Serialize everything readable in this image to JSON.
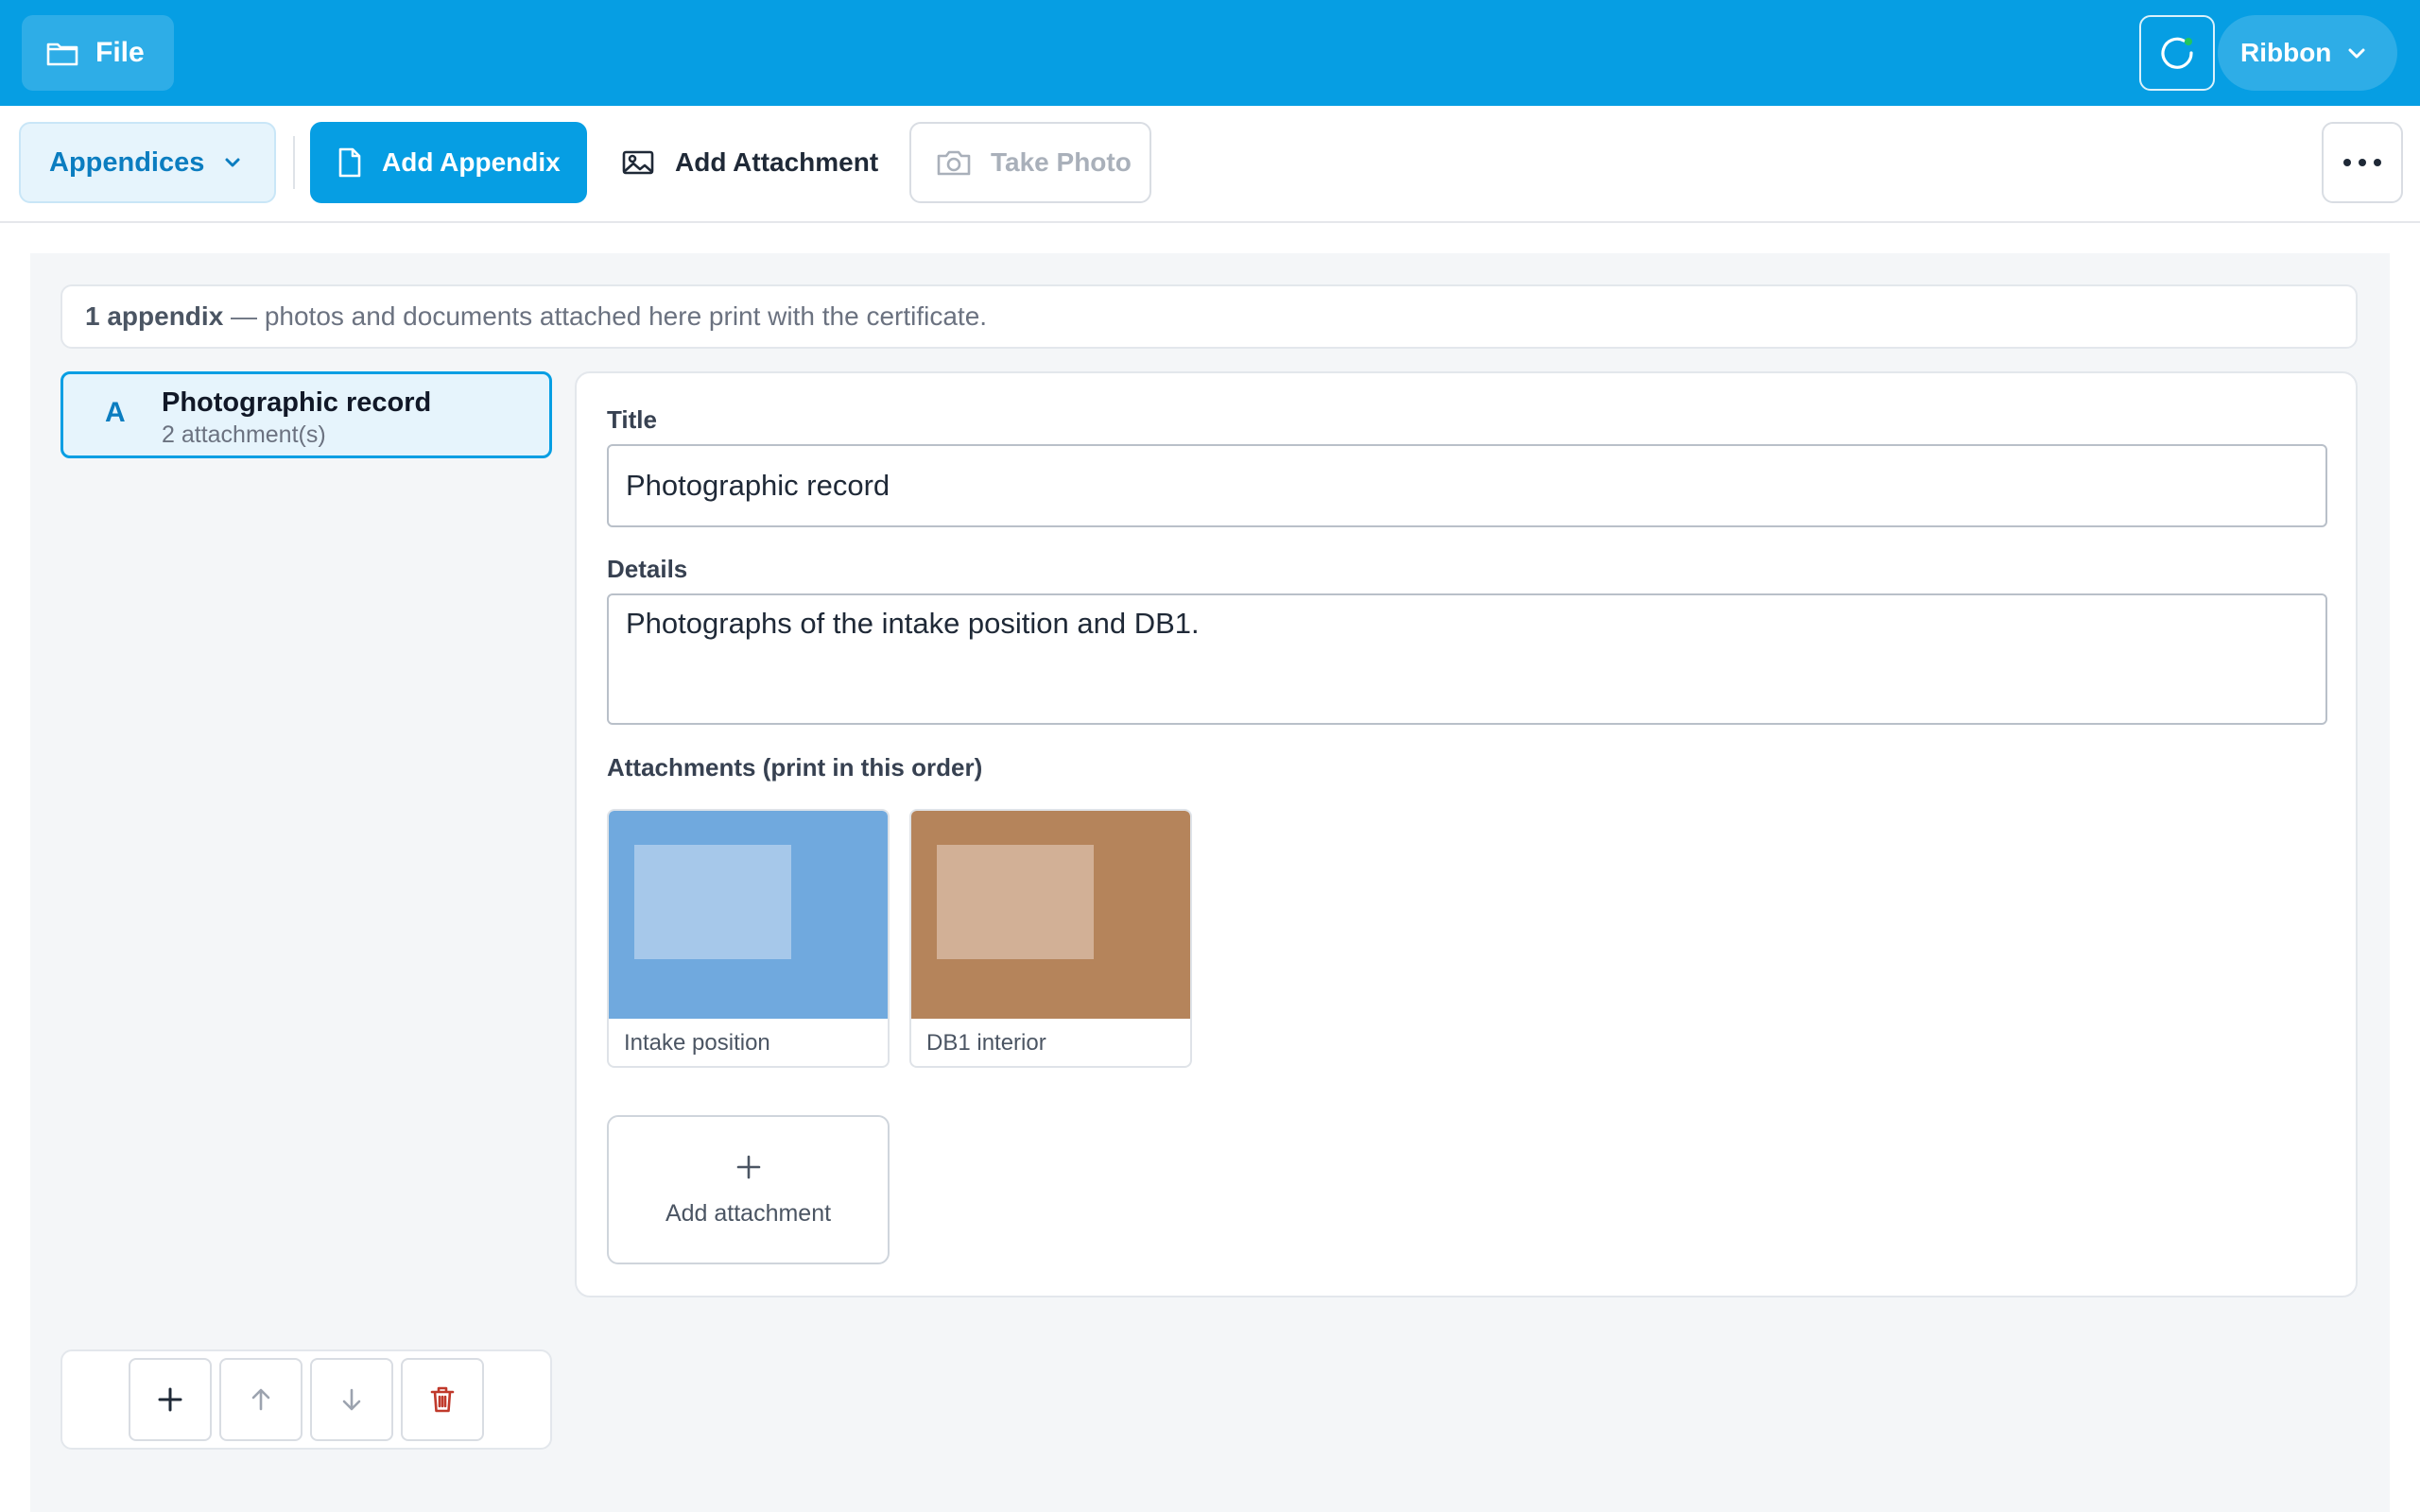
{
  "titlebar": {
    "file_label": "File",
    "ribbon_label": "Ribbon",
    "file_icon": "folder-icon",
    "sync_icon": "sync-icon",
    "ribbon_icon": "chevron-down-icon",
    "color": "#069ee3"
  },
  "toolbar": {
    "appendices_label": "Appendices",
    "add_appendix_label": "Add Appendix",
    "add_attachment_label": "Add Attachment",
    "take_photo_label": "Take Photo",
    "take_photo_disabled": true,
    "more_icon": "more-horizontal-icon"
  },
  "summary": {
    "count": "1 appendix",
    "text": " — photos and documents attached here print with the certificate."
  },
  "appendices": [
    {
      "letter": "A",
      "title": "Photographic record",
      "subtitle": "2 attachment(s)",
      "selected": true
    }
  ],
  "list_actions": {
    "icons": [
      "plus-icon",
      "arrow-up-icon",
      "arrow-down-icon",
      "trash-icon"
    ]
  },
  "detail": {
    "title_label": "Title",
    "title_value": "Photographic record",
    "details_label": "Details",
    "details_value": "Photographs of the intake position and DB1.",
    "attachments_label": "Attachments (print in this order)",
    "attachments": [
      {
        "caption": "Intake position",
        "color": "#70a9de",
        "inner_color": "#a6c8ea"
      },
      {
        "caption": "DB1 interior",
        "color": "#b5845b",
        "inner_color": "#d2b096"
      }
    ],
    "add_attachment_label": "Add attachment"
  },
  "colors": {
    "accent": "#069ee3",
    "accent_dark": "#0b7dc0",
    "danger": "#c0392b",
    "workspace_bg": "#f4f6f8"
  }
}
